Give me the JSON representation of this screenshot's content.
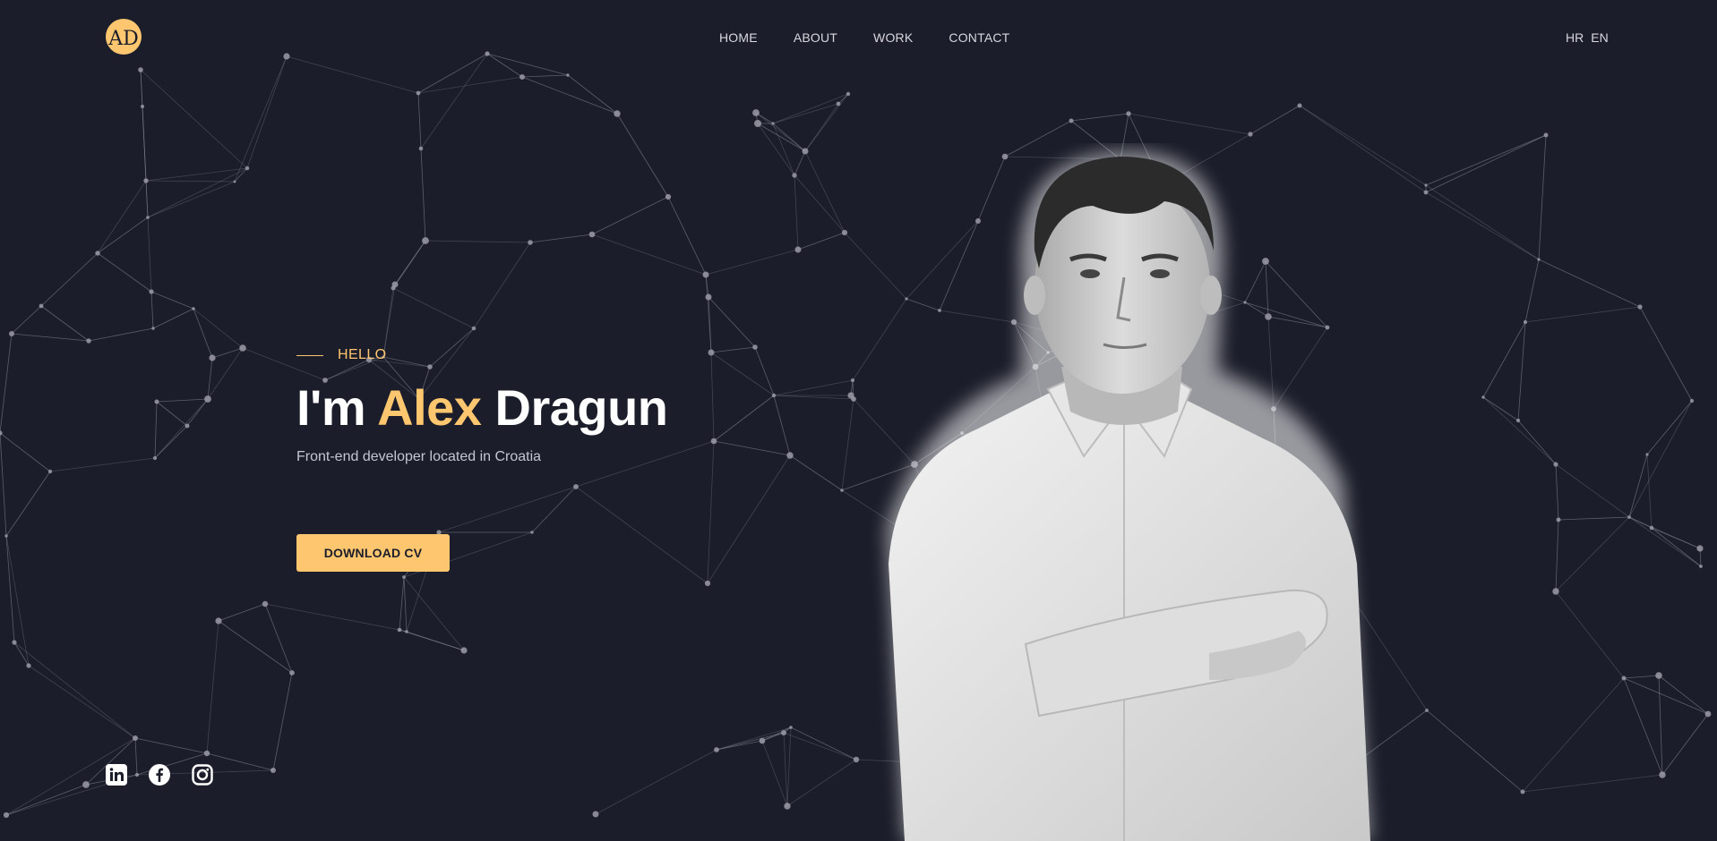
{
  "brand": {
    "logo_letters": "AD",
    "logo_color": "#fec76f"
  },
  "nav": [
    {
      "label": "HOME"
    },
    {
      "label": "ABOUT"
    },
    {
      "label": "WORK"
    },
    {
      "label": "CONTACT"
    }
  ],
  "lang": [
    {
      "label": "HR"
    },
    {
      "label": "EN"
    }
  ],
  "hero": {
    "eyebrow": "HELLO",
    "heading_prefix": "I'm",
    "heading_first": "Alex",
    "heading_last": "Dragun",
    "subtitle": "Front-end developer located in Croatia",
    "cta_label": "DOWNLOAD CV"
  },
  "social": [
    {
      "icon": "linkedin-icon"
    },
    {
      "icon": "facebook-icon"
    },
    {
      "icon": "instagram-icon"
    }
  ],
  "colors": {
    "background": "#1b1d2a",
    "accent": "#fec76f",
    "text": "#ffffff",
    "muted": "#c4c6d2"
  }
}
